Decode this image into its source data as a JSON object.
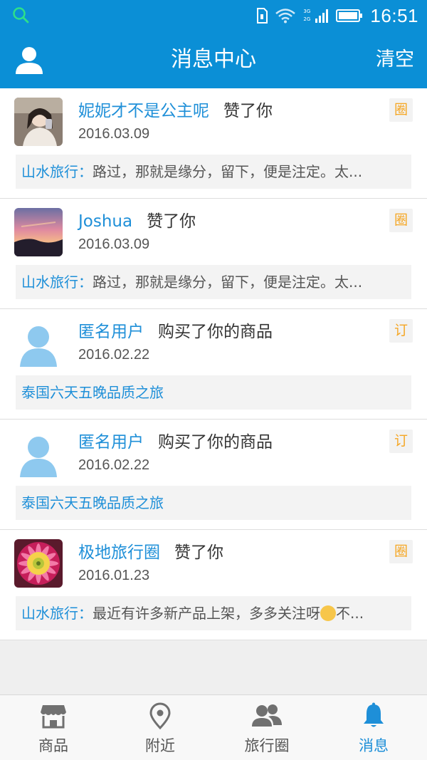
{
  "status_bar": {
    "time": "16:51",
    "signal_labels": [
      "3G",
      "2G"
    ],
    "icons": [
      "search-icon",
      "sim-card-icon",
      "wifi-icon",
      "signal-icon",
      "battery-icon"
    ]
  },
  "header": {
    "title": "消息中心",
    "clear_label": "清空",
    "avatar_icon": "user-icon"
  },
  "colors": {
    "brand": "#0b8fd6",
    "link": "#1e8fd8",
    "tag": "#f5a623"
  },
  "messages": [
    {
      "user": "妮妮才不是公主呢",
      "action": "赞了你",
      "date": "2016.03.09",
      "tag": "圈",
      "quote_source": "山水旅行：",
      "quote_text": "路过，那就是缘分，留下，便是注定。太..."
    },
    {
      "user": "Joshua",
      "action": "赞了你",
      "date": "2016.03.09",
      "tag": "圈",
      "quote_source": "山水旅行：",
      "quote_text": "路过，那就是缘分，留下，便是注定。太..."
    },
    {
      "user": "匿名用户",
      "action": "购买了你的商品",
      "date": "2016.02.22",
      "tag": "订",
      "quote_source": "泰国六天五晚品质之旅",
      "quote_text": ""
    },
    {
      "user": "匿名用户",
      "action": "购买了你的商品",
      "date": "2016.02.22",
      "tag": "订",
      "quote_source": "泰国六天五晚品质之旅",
      "quote_text": ""
    },
    {
      "user": "极地旅行圈",
      "action": "赞了你",
      "date": "2016.01.23",
      "tag": "圈",
      "quote_source": "山水旅行：",
      "quote_text": "最近有许多新产品上架，多多关注呀",
      "quote_suffix": "不..."
    }
  ],
  "tabs": [
    {
      "label": "商品",
      "icon": "shop-icon",
      "active": false
    },
    {
      "label": "附近",
      "icon": "location-pin-icon",
      "active": false
    },
    {
      "label": "旅行圈",
      "icon": "people-icon",
      "active": false
    },
    {
      "label": "消息",
      "icon": "bell-icon",
      "active": true
    }
  ]
}
